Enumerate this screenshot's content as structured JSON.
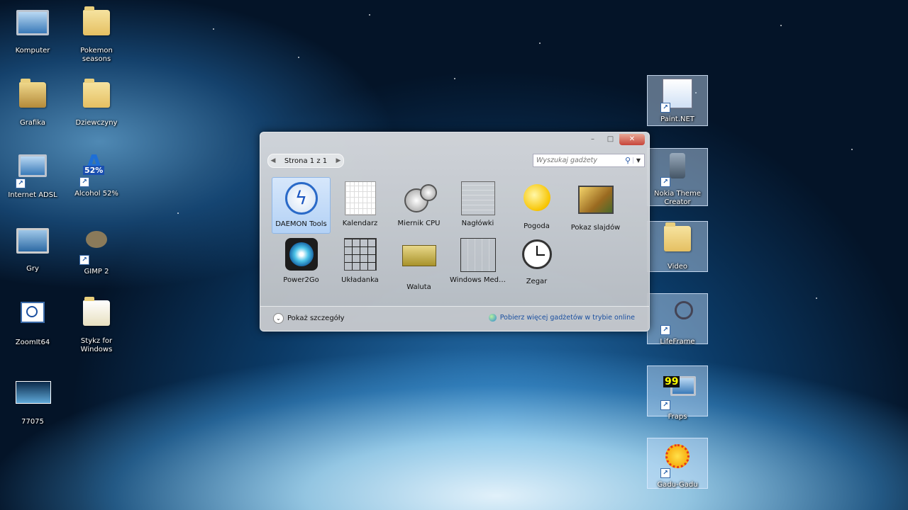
{
  "desktop": {
    "left_icons": [
      {
        "label": "Komputer",
        "icon": "computer-icon"
      },
      {
        "label": "Pokemon seasons",
        "icon": "folder-icon"
      },
      {
        "label": "Grafika",
        "icon": "folder-icon"
      },
      {
        "label": "Dziewczyny",
        "icon": "folder-icon"
      },
      {
        "label": "Internet ADSL",
        "icon": "network-icon"
      },
      {
        "label": "Alcohol 52%",
        "icon": "alcohol-icon",
        "badge": "52%"
      },
      {
        "label": "Gry",
        "icon": "games-icon"
      },
      {
        "label": "GIMP 2",
        "icon": "gimp-icon"
      },
      {
        "label": "ZoomIt64",
        "icon": "zoomit-icon"
      },
      {
        "label": "Stykz for Windows",
        "icon": "stykz-icon"
      },
      {
        "label": "77075",
        "icon": "image-icon"
      }
    ],
    "right_icons": [
      {
        "label": "Paint.NET",
        "icon": "paintnet-icon"
      },
      {
        "label": "Nokia Theme Creator",
        "icon": "nokia-icon"
      },
      {
        "label": "Video",
        "icon": "folder-icon"
      },
      {
        "label": "LifeFrame",
        "icon": "lifeframe-icon"
      },
      {
        "label": "Fraps",
        "icon": "fraps-icon",
        "badge": "99"
      },
      {
        "label": "Gadu-Gadu",
        "icon": "gadugadu-icon"
      }
    ]
  },
  "gadget_window": {
    "pager_text": "Strona 1 z 1",
    "search_placeholder": "Wyszukaj gadżety",
    "gadgets": [
      {
        "label": "DAEMON Tools",
        "icon": "daemon-tools-icon",
        "selected": true
      },
      {
        "label": "Kalendarz",
        "icon": "calendar-icon"
      },
      {
        "label": "Miernik CPU",
        "icon": "cpu-meter-icon"
      },
      {
        "label": "Nagłówki",
        "icon": "headlines-icon"
      },
      {
        "label": "Pogoda",
        "icon": "weather-icon"
      },
      {
        "label": "Pokaz slajdów",
        "icon": "slideshow-icon"
      },
      {
        "label": "Power2Go",
        "icon": "power2go-icon"
      },
      {
        "label": "Układanka",
        "icon": "puzzle-icon"
      },
      {
        "label": "Waluta",
        "icon": "currency-icon"
      },
      {
        "label": "Windows Media...",
        "icon": "windows-media-icon"
      },
      {
        "label": "Zegar",
        "icon": "clock-icon"
      }
    ],
    "details_label": "Pokaż szczegóły",
    "online_link": "Pobierz więcej gadżetów w trybie online"
  },
  "colors": {
    "selection": "#b3d1f5",
    "link": "#1a4fa0",
    "close": "#c7453a"
  }
}
